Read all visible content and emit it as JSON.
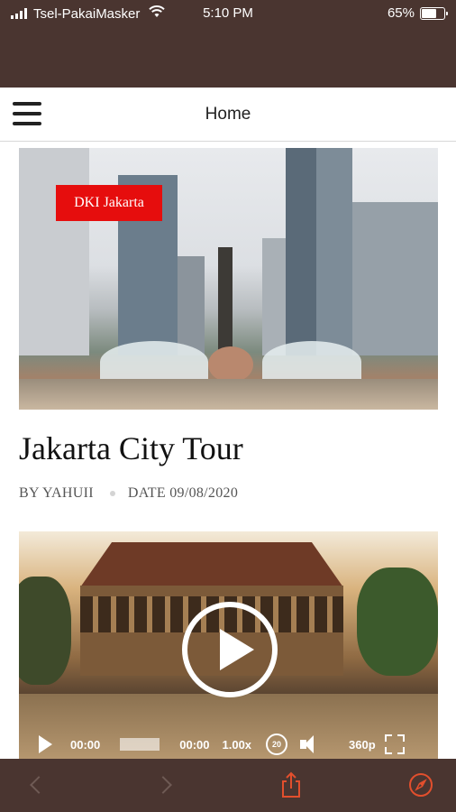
{
  "status_bar": {
    "carrier": "Tsel-PakaiMasker",
    "time": "5:10 PM",
    "battery_percent": "65%",
    "battery_level": 0.65
  },
  "navbar": {
    "title": "Home"
  },
  "post": {
    "category_tag": "DKI Jakarta",
    "title": "Jakarta City Tour",
    "author": "BY YAHUII",
    "date": "DATE 09/08/2020"
  },
  "video_player": {
    "current_time": "00:00",
    "duration": "00:00",
    "speed": "1.00x",
    "replay_seconds": "20",
    "quality": "360p"
  },
  "colors": {
    "bar_background": "#4a3530",
    "accent": "#e24f2d",
    "tag_red": "#e60d0d"
  },
  "toolbar": {
    "icons": [
      "back-arrow-icon",
      "forward-arrow-icon",
      "share-icon",
      "compass-icon"
    ]
  }
}
